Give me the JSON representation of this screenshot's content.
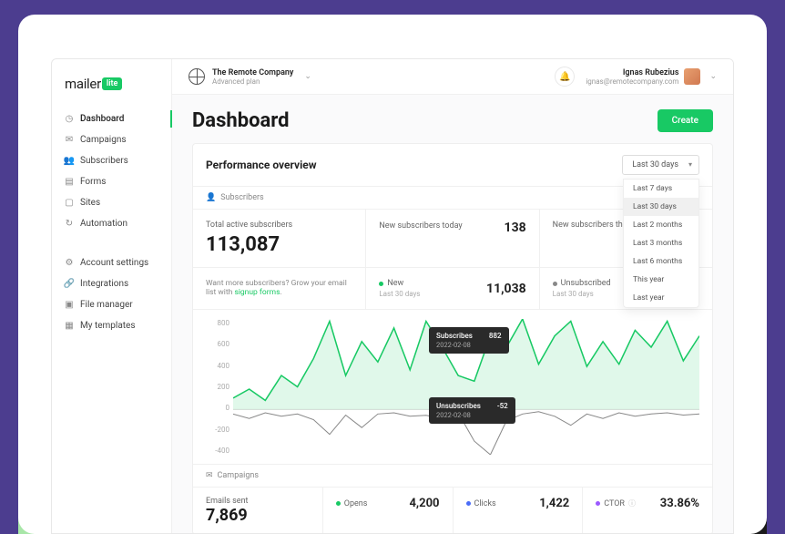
{
  "logo": {
    "text": "mailer",
    "badge": "lite"
  },
  "nav": {
    "main": [
      {
        "label": "Dashboard",
        "icon": "clock-icon",
        "active": true
      },
      {
        "label": "Campaigns",
        "icon": "mail-icon"
      },
      {
        "label": "Subscribers",
        "icon": "users-icon"
      },
      {
        "label": "Forms",
        "icon": "form-icon"
      },
      {
        "label": "Sites",
        "icon": "window-icon"
      },
      {
        "label": "Automation",
        "icon": "refresh-icon"
      }
    ],
    "secondary": [
      {
        "label": "Account settings",
        "icon": "gear-icon"
      },
      {
        "label": "Integrations",
        "icon": "link-icon"
      },
      {
        "label": "File manager",
        "icon": "folder-icon"
      },
      {
        "label": "My templates",
        "icon": "template-icon"
      }
    ]
  },
  "topbar": {
    "company_name": "The Remote Company",
    "plan": "Advanced plan",
    "user_name": "Ignas Rubezius",
    "user_email": "ignas@remotecompany.com"
  },
  "page": {
    "title": "Dashboard",
    "create_label": "Create"
  },
  "overview": {
    "title": "Performance overview",
    "date_selected": "Last 30 days",
    "date_options": [
      "Last 7 days",
      "Last 30 days",
      "Last 2 months",
      "Last 3 months",
      "Last 6 months",
      "This year",
      "Last year"
    ],
    "subscribers_section": "Subscribers",
    "total_label": "Total active subscribers",
    "total_value": "113,087",
    "new_today_label": "New subscribers today",
    "new_today_value": "138",
    "new_month_label": "New subscribers th",
    "new_label": "New",
    "new_value": "11,038",
    "period": "Last 30 days",
    "unsub_label": "Unsubscribed",
    "help_text": "Want more subscribers? Grow your email list with ",
    "help_link": "signup forms",
    "campaigns_section": "Campaigns",
    "emails_sent_label": "Emails sent",
    "emails_sent_value": "7,869",
    "opens_label": "Opens",
    "opens_value": "4,200",
    "clicks_label": "Clicks",
    "clicks_value": "1,422",
    "ctor_label": "CTOR",
    "ctor_value": "33.86%"
  },
  "chart_data": {
    "type": "line",
    "ylim": [
      -400,
      800
    ],
    "y_ticks": [
      800,
      600,
      400,
      200,
      0,
      -200,
      -400
    ],
    "series": [
      {
        "name": "Subscribes",
        "color": "#18c964",
        "values": [
          100,
          180,
          80,
          300,
          200,
          450,
          780,
          300,
          600,
          420,
          720,
          350,
          780,
          550,
          300,
          250,
          650,
          550,
          800,
          400,
          650,
          780,
          380,
          600,
          400,
          700,
          550,
          780,
          430,
          650
        ]
      },
      {
        "name": "Unsubscribes",
        "color": "#888",
        "values": [
          -40,
          -80,
          -30,
          -60,
          -40,
          -90,
          -220,
          -50,
          -160,
          -40,
          -30,
          -60,
          -52,
          -80,
          -30,
          -280,
          -400,
          -100,
          -40,
          -20,
          -60,
          -140,
          -40,
          -80,
          -30,
          -60,
          -40,
          -30,
          -50,
          -40
        ]
      }
    ],
    "tooltips": [
      {
        "series": "Subscribes",
        "value": 882,
        "date": "2022-02-08",
        "x_pct": 42,
        "y_pct": 6
      },
      {
        "series": "Unsubscribes",
        "value": -52,
        "date": "2022-02-08",
        "x_pct": 42,
        "y_pct": 58
      }
    ]
  }
}
